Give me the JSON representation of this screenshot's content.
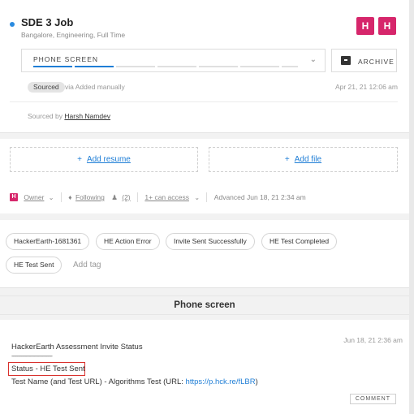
{
  "job": {
    "title": "SDE 3 Job",
    "subtitle": "Bangalore, Engineering, Full Time",
    "badges": [
      "H",
      "H"
    ],
    "badge_color": "#d6266b"
  },
  "stage": {
    "label": "PHONE SCREEN",
    "progress_segments": 7,
    "completed_segments": 2,
    "active_color": "#1f7ed6"
  },
  "archive": {
    "label": "ARCHIVE",
    "icon": "archive-icon"
  },
  "source": {
    "pill": "Sourced",
    "via": "via Added manually",
    "date": "Apr 21, 21 12:06 am",
    "sourced_by_label": "Sourced by",
    "sourced_by_name": "Harsh Namdev"
  },
  "attachments": {
    "add_resume": "Add resume",
    "add_file": "Add file"
  },
  "owner_row": {
    "avatar": "H",
    "owner": "Owner",
    "following": "Following",
    "followers": "(2)",
    "access": "1+ can access",
    "advanced": "Advanced Jun 18, 21 2:34 am"
  },
  "tags": [
    "HackerEarth-1681361",
    "HE Action Error",
    "Invite Sent Successfully",
    "HE Test Completed",
    "HE Test Sent"
  ],
  "add_tag": "Add tag",
  "section_title": "Phone screen",
  "note": {
    "date": "Jun 18, 21 2:36 am",
    "heading": "HackerEarth Assessment Invite Status",
    "dashes": "------------------------------",
    "status": "Status - HE Test Sent",
    "test_prefix": "Test Name (and Test URL) - Algorithms Test (URL: ",
    "test_url": "https://p.hck.re/fLBR",
    "test_suffix": ")",
    "comment_button": "COMMENT"
  }
}
